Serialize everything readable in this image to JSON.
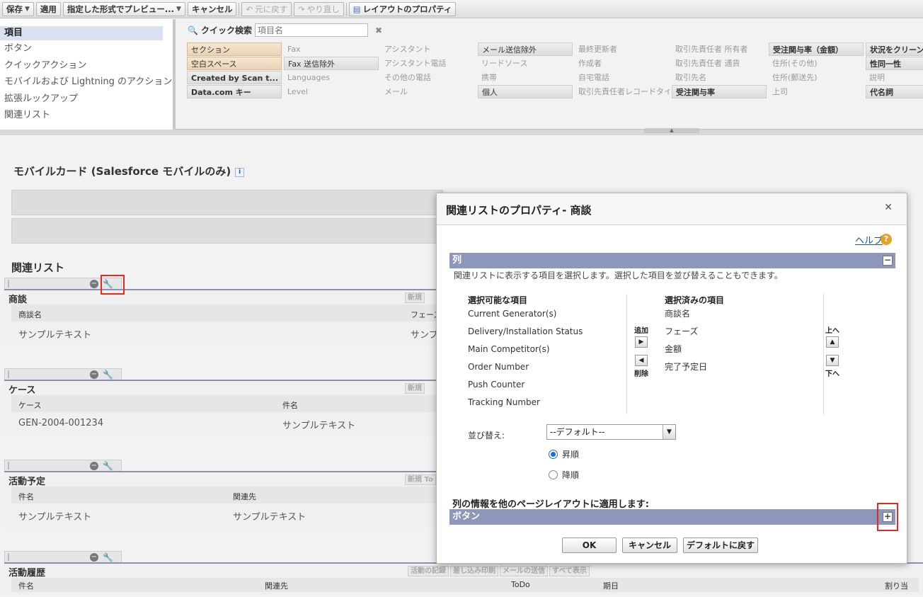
{
  "toolbar": {
    "save": "保存",
    "apply": "適用",
    "preview": "指定した形式でプレビュー...",
    "cancel": "キャンセル",
    "undo": "元に戻す",
    "redo": "やり直し",
    "layout_props": "レイアウトのプロパティ"
  },
  "palette": {
    "categories": [
      "項目",
      "ボタン",
      "クイックアクション",
      "モバイルおよび Lightning のアクション",
      "拡張ルックアップ",
      "関連リスト"
    ],
    "quick_search_label": "クイック検索",
    "quick_search_placeholder": "項目名",
    "fields": [
      [
        "セクション",
        "Fax",
        "アシスタント",
        "メール送信除外",
        "最終更新者",
        "取引先責任者 所有者",
        "受注関与率（金額）",
        "状況をクリーン"
      ],
      [
        "空白スペース",
        "Fax 送信除外",
        "アシスタント電話",
        "リードソース",
        "作成者",
        "取引先責任者 通貨",
        "住所(その他)",
        "性同一性"
      ],
      [
        "Created by Scan t...",
        "Languages",
        "その他の電話",
        "携帯",
        "自宅電話",
        "取引先名",
        "住所(郵送先)",
        "説明"
      ],
      [
        "Data.com キー",
        "Level",
        "メール",
        "個人",
        "取引先責任者レコードタイプ",
        "受注関与率",
        "上司",
        "代名詞"
      ]
    ]
  },
  "canvas": {
    "mobile_card_title": "モバイルカード (Salesforce モバイルのみ)",
    "related_list_title": "関連リスト",
    "sections": [
      {
        "title": "商談",
        "buttons": [
          "新規"
        ],
        "cols": [
          "商談名",
          "フェーズ"
        ],
        "row": [
          "サンプルテキスト",
          "サンプ"
        ]
      },
      {
        "title": "ケース",
        "buttons": [
          "新規"
        ],
        "cols": [
          "ケース",
          "件名"
        ],
        "row": [
          "GEN-2004-001234",
          "サンプルテキスト"
        ]
      },
      {
        "title": "活動予定",
        "buttons": [
          "新規 To"
        ],
        "cols": [
          "件名",
          "関連先"
        ],
        "row": [
          "サンプルテキスト",
          "サンプルテキスト"
        ]
      },
      {
        "title": "活動履歴",
        "buttons": [
          "活動の記録",
          "差し込み印刷",
          "メールの送信",
          "すべて表示"
        ],
        "cols": [
          "件名",
          "関連先",
          "ToDo",
          "期日",
          "割り当"
        ]
      }
    ]
  },
  "dialog": {
    "title": "関連リストのプロパティ- 商談",
    "help": "ヘルプ",
    "columns_bar": "列",
    "columns_desc": "関連リストに表示する項目を選択します。選択した項目を並び替えることもできます。",
    "available_label": "選択可能な項目",
    "available": [
      "Current Generator(s)",
      "Delivery/Installation Status",
      "Main Competitor(s)",
      "Order Number",
      "Push Counter",
      "Tracking Number"
    ],
    "add_label": "追加",
    "remove_label": "削除",
    "selected_label": "選択済みの項目",
    "selected": [
      "商談名",
      "フェーズ",
      "金額",
      "完了予定日"
    ],
    "up_label": "上へ",
    "down_label": "下へ",
    "sort_label": "並び替え:",
    "sort_value": "--デフォルト--",
    "asc": "昇順",
    "desc": "降順",
    "apply_other": "列の情報を他のページレイアウトに適用します:",
    "buttons_bar": "ボタン",
    "ok": "OK",
    "cancel": "キャンセル",
    "reset": "デフォルトに戻す"
  }
}
